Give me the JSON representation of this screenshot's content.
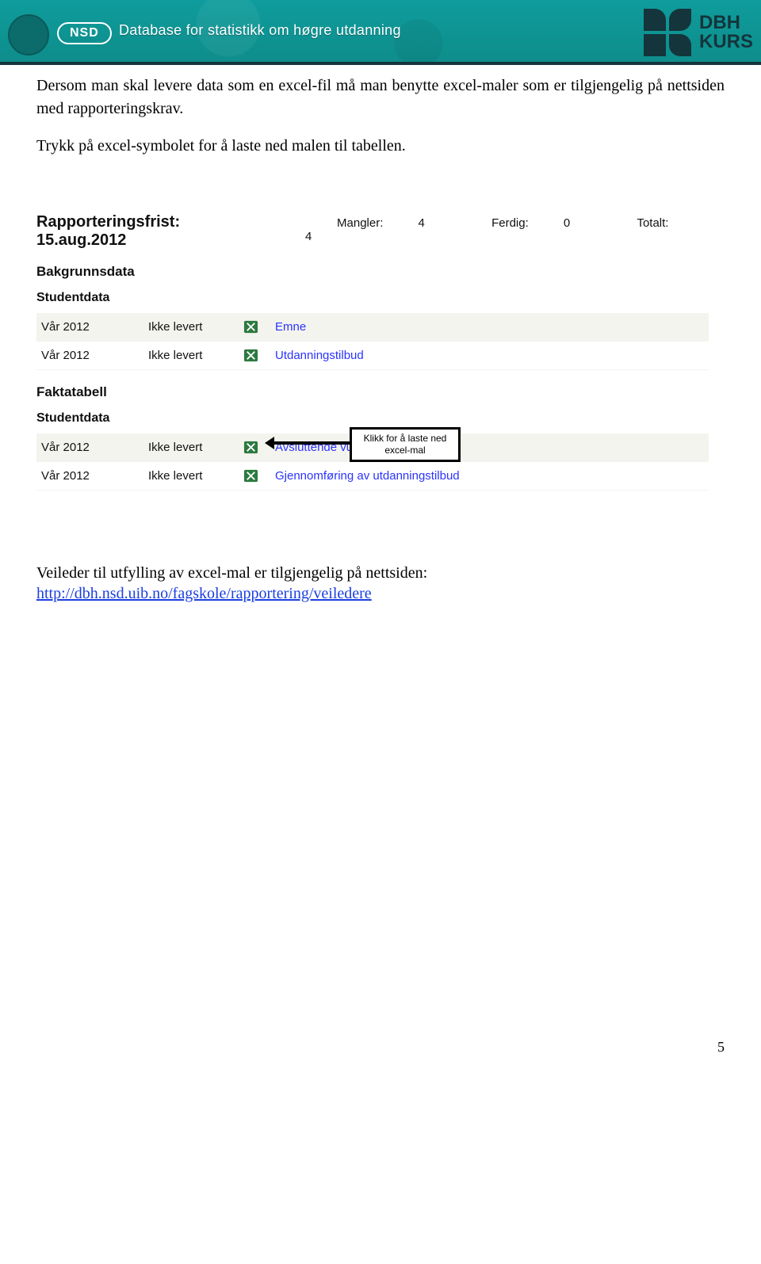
{
  "banner": {
    "nsd": "NSD",
    "title": "Database for statistikk om høgre utdanning",
    "logo_line1": "DBH",
    "logo_line2": "KURS"
  },
  "paragraphs": {
    "p1": "Dersom man skal levere data som en excel-fil må man benytte excel-maler som er tilgjengelig på nettsiden med rapporteringskrav.",
    "p2": "Trykk på excel-symbolet for å laste ned malen til tabellen."
  },
  "screenshot": {
    "deadline_label": "Rapporteringsfrist: 15.aug.2012",
    "stats": {
      "mangler_label": "Mangler:",
      "mangler_val": "4",
      "ferdig_label": "Ferdig:",
      "ferdig_val": "0",
      "totalt_label": "Totalt:",
      "totalt_val": "4"
    },
    "section1": "Bakgrunnsdata",
    "sub1": "Studentdata",
    "rows1": [
      {
        "period": "Vår 2012",
        "status": "Ikke levert",
        "link": "Emne"
      },
      {
        "period": "Vår 2012",
        "status": "Ikke levert",
        "link": "Utdanningstilbud"
      }
    ],
    "section2": "Faktatabell",
    "sub2": "Studentdata",
    "rows2": [
      {
        "period": "Vår 2012",
        "status": "Ikke levert",
        "link": "Avsluttende vurdering"
      },
      {
        "period": "Vår 2012",
        "status": "Ikke levert",
        "link": "Gjennomføring av utdanningstilbud"
      }
    ],
    "callout": "Klikk for å laste ned excel-mal"
  },
  "footer": {
    "veileder_text": "Veileder til utfylling av excel-mal er tilgjengelig på nettsiden:",
    "link_text": "http://dbh.nsd.uib.no/fagskole/rapportering/veiledere"
  },
  "page_number": "5"
}
